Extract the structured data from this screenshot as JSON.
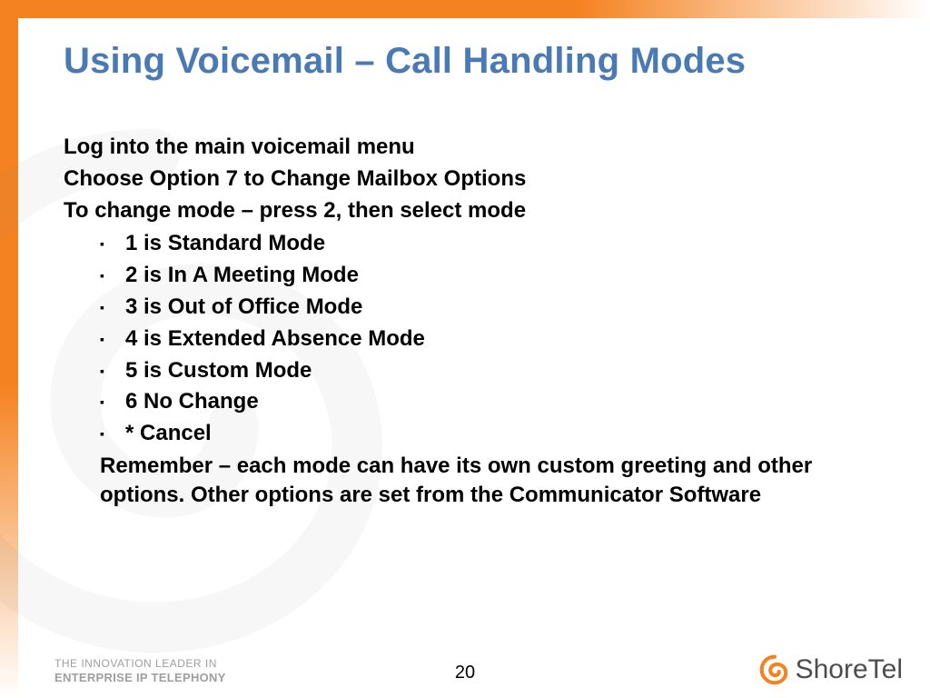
{
  "title": "Using Voicemail – Call Handling Modes",
  "intro": {
    "line1": "Log into the main voicemail menu",
    "line2": "Choose Option 7 to Change Mailbox Options",
    "line3": "To change mode – press 2, then select mode"
  },
  "modes": [
    "1 is Standard Mode",
    "2 is In A Meeting Mode",
    "3 is Out of Office Mode",
    "4 is Extended Absence Mode",
    "5 is Custom Mode",
    "6 No Change",
    "* Cancel"
  ],
  "remember": "Remember – each mode can have its own custom greeting and other options. Other options are set from the Communicator Software",
  "footer": {
    "tagline_line1": "THE INNOVATION LEADER IN",
    "tagline_line2": "ENTERPRISE IP TELEPHONY",
    "page_number": "20",
    "brand_name": "ShoreTel"
  },
  "colors": {
    "accent_orange": "#f58220",
    "title_blue": "#4a7ab5",
    "muted_gray": "#9e9e9e"
  }
}
